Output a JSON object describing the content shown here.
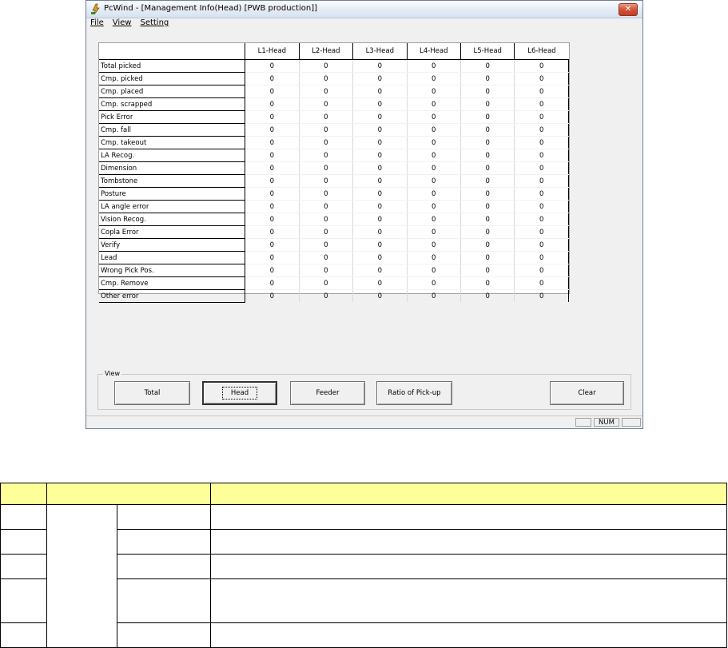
{
  "window": {
    "title": "PcWind - [Management Info(Head) [PWB production]]",
    "close_label": "✕"
  },
  "menu": {
    "file": "File",
    "view": "View",
    "setting": "Setting"
  },
  "grid": {
    "columns": [
      "L1-Head",
      "L2-Head",
      "L3-Head",
      "L4-Head",
      "L5-Head",
      "L6-Head"
    ],
    "rows": [
      {
        "label": "Total picked",
        "values": [
          "0",
          "0",
          "0",
          "0",
          "0",
          "0"
        ]
      },
      {
        "label": "Cmp. picked",
        "values": [
          "0",
          "0",
          "0",
          "0",
          "0",
          "0"
        ]
      },
      {
        "label": "Cmp. placed",
        "values": [
          "0",
          "0",
          "0",
          "0",
          "0",
          "0"
        ]
      },
      {
        "label": "Cmp. scrapped",
        "values": [
          "0",
          "0",
          "0",
          "0",
          "0",
          "0"
        ]
      },
      {
        "label": "Pick Error",
        "values": [
          "0",
          "0",
          "0",
          "0",
          "0",
          "0"
        ]
      },
      {
        "label": "Cmp. fall",
        "values": [
          "0",
          "0",
          "0",
          "0",
          "0",
          "0"
        ]
      },
      {
        "label": "Cmp. takeout",
        "values": [
          "0",
          "0",
          "0",
          "0",
          "0",
          "0"
        ]
      },
      {
        "label": "LA Recog.",
        "values": [
          "0",
          "0",
          "0",
          "0",
          "0",
          "0"
        ]
      },
      {
        "label": "Dimension",
        "values": [
          "0",
          "0",
          "0",
          "0",
          "0",
          "0"
        ]
      },
      {
        "label": "Tombstone",
        "values": [
          "0",
          "0",
          "0",
          "0",
          "0",
          "0"
        ]
      },
      {
        "label": "Posture",
        "values": [
          "0",
          "0",
          "0",
          "0",
          "0",
          "0"
        ]
      },
      {
        "label": "LA angle error",
        "values": [
          "0",
          "0",
          "0",
          "0",
          "0",
          "0"
        ]
      },
      {
        "label": "Vision Recog.",
        "values": [
          "0",
          "0",
          "0",
          "0",
          "0",
          "0"
        ]
      },
      {
        "label": "Copla Error",
        "values": [
          "0",
          "0",
          "0",
          "0",
          "0",
          "0"
        ]
      },
      {
        "label": "Verify",
        "values": [
          "0",
          "0",
          "0",
          "0",
          "0",
          "0"
        ]
      },
      {
        "label": "Lead",
        "values": [
          "0",
          "0",
          "0",
          "0",
          "0",
          "0"
        ]
      },
      {
        "label": "Wrong Pick Pos.",
        "values": [
          "0",
          "0",
          "0",
          "0",
          "0",
          "0"
        ]
      },
      {
        "label": "Cmp. Remove",
        "values": [
          "0",
          "0",
          "0",
          "0",
          "0",
          "0"
        ]
      },
      {
        "label": "Other error",
        "values": [
          "0",
          "0",
          "0",
          "0",
          "0",
          "0"
        ]
      }
    ]
  },
  "view_group": {
    "legend": "View",
    "buttons": {
      "total": "Total",
      "head": "Head",
      "feeder": "Feeder",
      "ratio": "Ratio of Pick-up",
      "clear": "Clear"
    },
    "active": "Head"
  },
  "status": {
    "num": "NUM"
  },
  "colors": {
    "doc_header_bg": "#ffff99",
    "close_button": "#c9442c"
  }
}
